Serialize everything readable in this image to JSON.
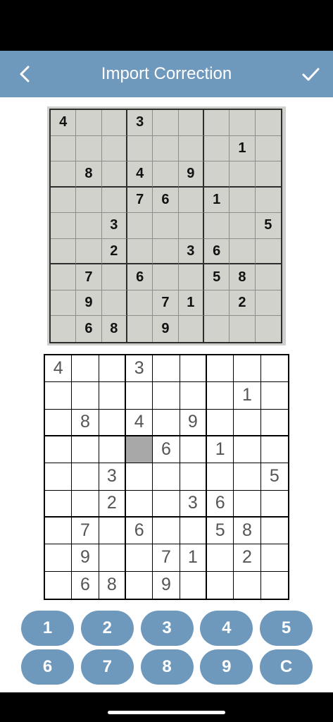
{
  "header": {
    "title": "Import Correction",
    "back_icon": "chevron-left-icon",
    "confirm_icon": "checkmark-icon",
    "background_color": "#6f98bd"
  },
  "scanned_photo": {
    "grid": [
      [
        "4",
        "",
        "",
        "3",
        "",
        "",
        "",
        "",
        ""
      ],
      [
        "",
        "",
        "",
        "",
        "",
        "",
        "",
        "1",
        ""
      ],
      [
        "",
        "8",
        "",
        "4",
        "",
        "9",
        "",
        "",
        ""
      ],
      [
        "",
        "",
        "",
        "7",
        "6",
        "",
        "1",
        "",
        ""
      ],
      [
        "",
        "",
        "3",
        "",
        "",
        "",
        "",
        "",
        "5"
      ],
      [
        "",
        "",
        "2",
        "",
        "",
        "3",
        "6",
        "",
        ""
      ],
      [
        "",
        "7",
        "",
        "6",
        "",
        "",
        "5",
        "8",
        ""
      ],
      [
        "",
        "9",
        "",
        "",
        "7",
        "1",
        "",
        "2",
        ""
      ],
      [
        "",
        "6",
        "8",
        "",
        "9",
        "",
        "",
        "",
        ""
      ]
    ]
  },
  "board": {
    "selected_cell": [
      3,
      3
    ],
    "grid": [
      [
        "4",
        "",
        "",
        "3",
        "",
        "",
        "",
        "",
        ""
      ],
      [
        "",
        "",
        "",
        "",
        "",
        "",
        "",
        "1",
        ""
      ],
      [
        "",
        "8",
        "",
        "4",
        "",
        "9",
        "",
        "",
        ""
      ],
      [
        "",
        "",
        "",
        "",
        "6",
        "",
        "1",
        "",
        ""
      ],
      [
        "",
        "",
        "3",
        "",
        "",
        "",
        "",
        "",
        "5"
      ],
      [
        "",
        "",
        "2",
        "",
        "",
        "3",
        "6",
        "",
        ""
      ],
      [
        "",
        "7",
        "",
        "6",
        "",
        "",
        "5",
        "8",
        ""
      ],
      [
        "",
        "9",
        "",
        "",
        "7",
        "1",
        "",
        "2",
        ""
      ],
      [
        "",
        "6",
        "8",
        "",
        "9",
        "",
        "",
        "",
        ""
      ]
    ]
  },
  "keypad": {
    "keys": [
      "1",
      "2",
      "3",
      "4",
      "5",
      "6",
      "7",
      "8",
      "9",
      "C"
    ],
    "key_color": "#6f98bd"
  }
}
